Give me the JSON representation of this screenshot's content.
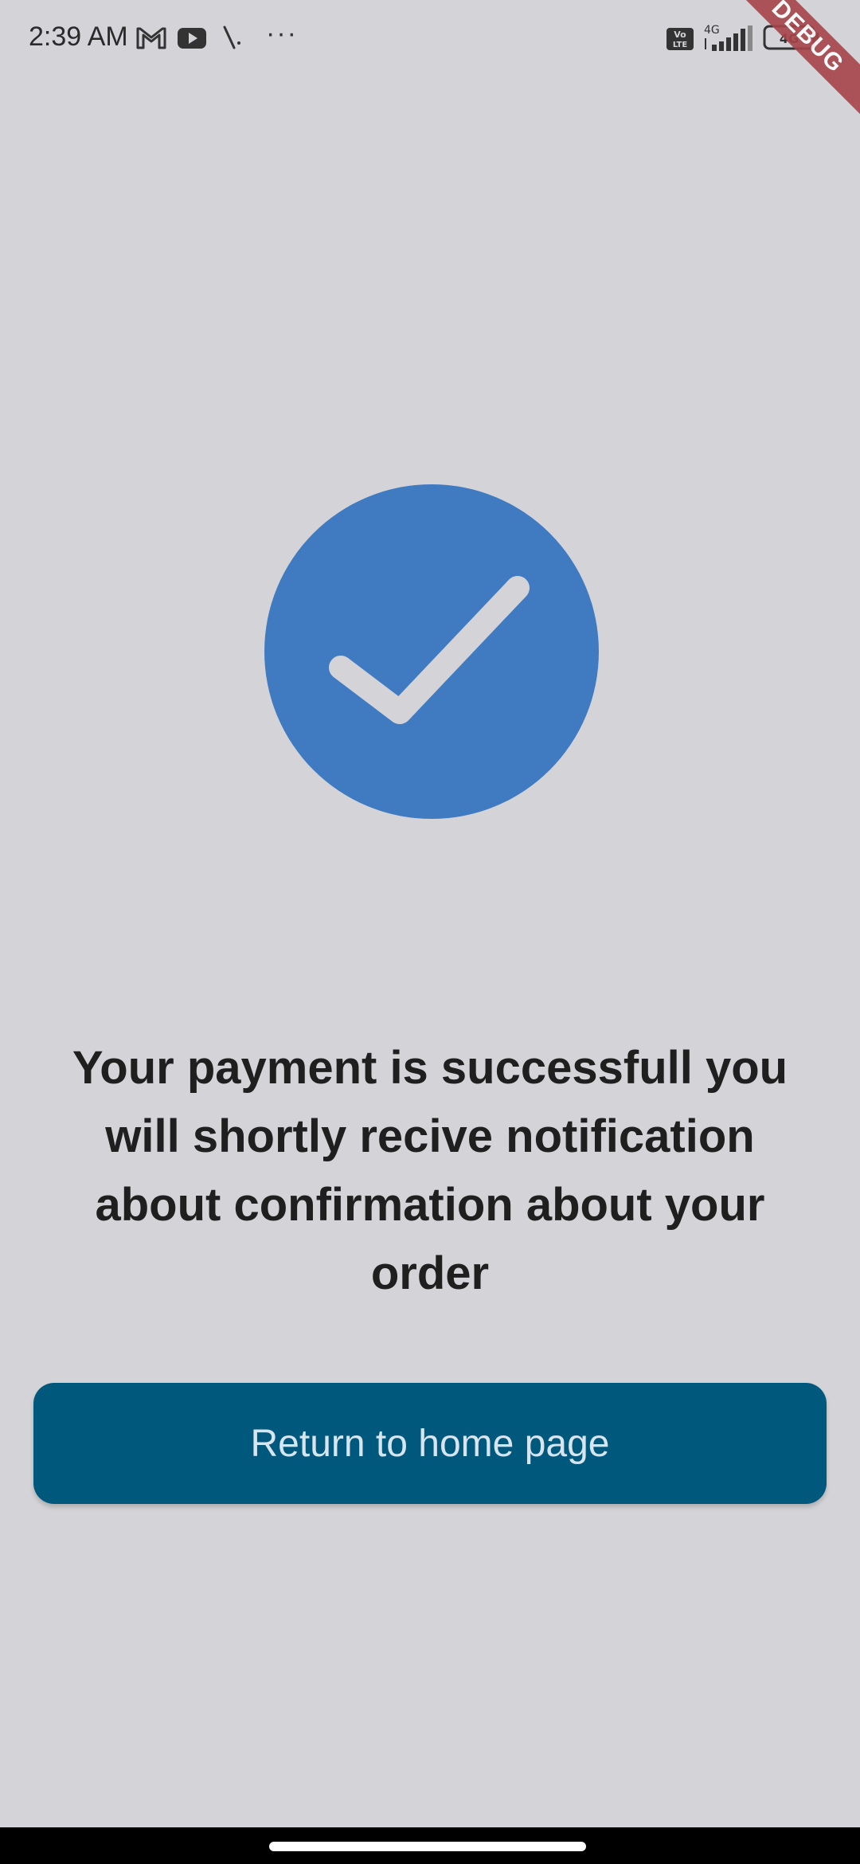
{
  "status_bar": {
    "time": "2:39 AM",
    "more": "···",
    "icons": [
      "gmail-icon",
      "youtube-icon",
      "app-icon",
      "volte-icon",
      "signal-4g-icon",
      "battery-icon"
    ],
    "network_label": "4G",
    "volte_label_top": "Vo",
    "volte_label_bottom": "LTE"
  },
  "debug_banner": {
    "label": "DEBUG",
    "color": "#a6454a"
  },
  "success": {
    "icon": "check-circle-icon",
    "color": "#407bc2"
  },
  "message": {
    "text": "Your payment is successfull you will shortly recive notification about confirmation about your order"
  },
  "actions": {
    "return_home_label": "Return to home page",
    "button_color": "#00587d"
  }
}
